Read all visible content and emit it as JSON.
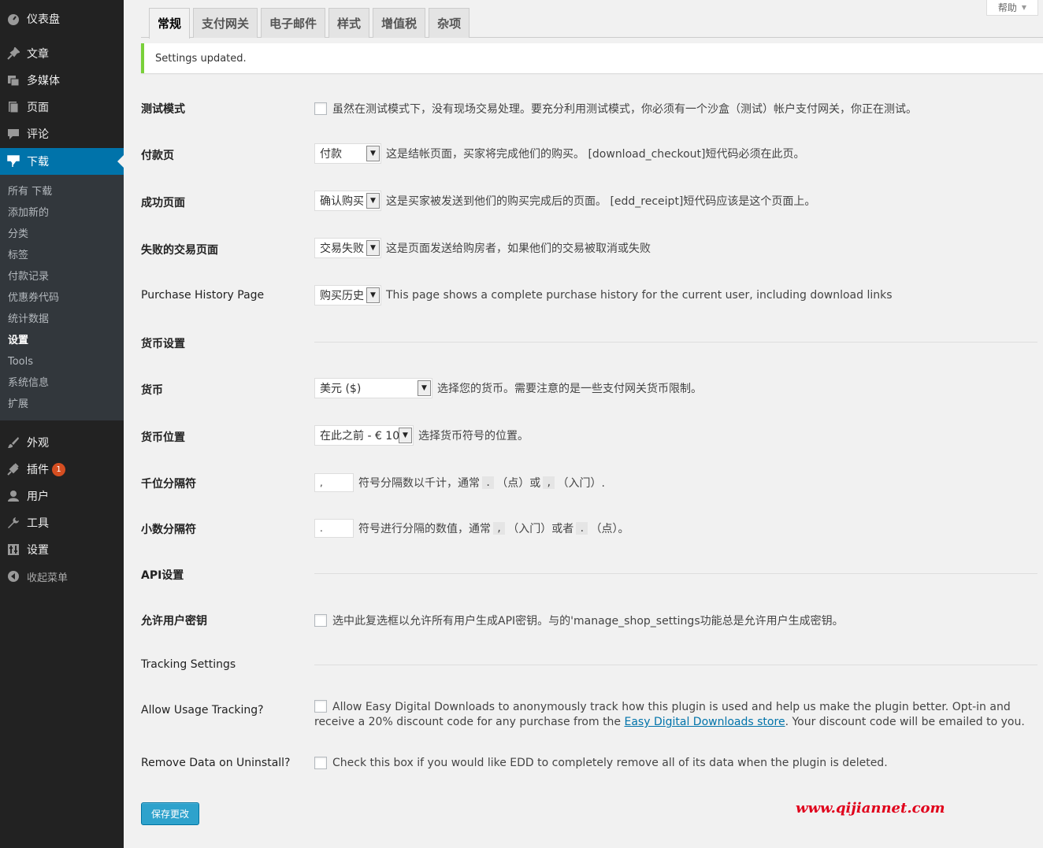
{
  "sidebar": {
    "top_items": [
      {
        "label": "仪表盘",
        "icon": "dashboard-icon"
      },
      {
        "label": "文章",
        "icon": "pin-icon"
      },
      {
        "label": "多媒体",
        "icon": "media-icon"
      },
      {
        "label": "页面",
        "icon": "page-icon"
      },
      {
        "label": "评论",
        "icon": "comment-icon"
      },
      {
        "label": "下载",
        "icon": "download-icon"
      }
    ],
    "submenu": [
      "所有 下载",
      "添加新的",
      "分类",
      "标签",
      "付款记录",
      "优惠券代码",
      "统计数据",
      "设置",
      "Tools",
      "系统信息",
      "扩展"
    ],
    "bottom_items": [
      {
        "label": "外观",
        "icon": "brush-icon"
      },
      {
        "label": "插件",
        "icon": "plugin-icon",
        "badge": "1"
      },
      {
        "label": "用户",
        "icon": "user-icon"
      },
      {
        "label": "工具",
        "icon": "wrench-icon"
      },
      {
        "label": "设置",
        "icon": "settings-icon"
      }
    ],
    "collapse": "收起菜单"
  },
  "help": "帮助",
  "tabs": [
    "常规",
    "支付网关",
    "电子邮件",
    "样式",
    "增值税",
    "杂项"
  ],
  "notice": "Settings updated.",
  "settings": {
    "test_mode": {
      "label": "测试模式",
      "desc": "虽然在测试模式下，没有现场交易处理。要充分利用测试模式，你必须有一个沙盒（测试）帐户支付网关，你正在测试。"
    },
    "checkout": {
      "label": "付款页",
      "value": "付款",
      "desc": "这是结帐页面，买家将完成他们的购买。 [download_checkout]短代码必须在此页。"
    },
    "success": {
      "label": "成功页面",
      "value": "确认购买",
      "desc": "这是买家被发送到他们的购买完成后的页面。 [edd_receipt]短代码应该是这个页面上。"
    },
    "failure": {
      "label": "失败的交易页面",
      "value": "交易失败",
      "desc": "这是页面发送给购房者，如果他们的交易被取消或失败"
    },
    "history": {
      "label": "Purchase History Page",
      "value": "购买历史",
      "desc": "This page shows a complete purchase history for the current user, including download links"
    },
    "currency_section": "货币设置",
    "currency": {
      "label": "货币",
      "value": "美元 ($)",
      "desc": "选择您的货币。需要注意的是一些支付网关货币限制。"
    },
    "currency_position": {
      "label": "货币位置",
      "value": "在此之前 - € 10",
      "desc": "选择货币符号的位置。"
    },
    "thousands": {
      "label": "千位分隔符",
      "value": ",",
      "desc1": "符号分隔数以千计，通常",
      "code1": ".",
      "desc2": "（点）或",
      "code2": ",",
      "desc3": "（入门）."
    },
    "decimal": {
      "label": "小数分隔符",
      "value": ".",
      "desc1": "符号进行分隔的数值，通常",
      "code1": ",",
      "desc2": "（入门）或者",
      "code2": ".",
      "desc3": "（点）。"
    },
    "api_section": "API设置",
    "api_keys": {
      "label": "允许用户密钥",
      "desc": "选中此复选框以允许所有用户生成API密钥。与的'manage_shop_settings功能总是允许用户生成密钥。"
    },
    "tracking_section": "Tracking Settings",
    "tracking": {
      "label": "Allow Usage Tracking?",
      "desc1": "Allow Easy Digital Downloads to anonymously track how this plugin is used and help us make the plugin better. Opt-in and receive a 20% discount code for any purchase from the",
      "link": "Easy Digital Downloads store",
      "desc2": ". Your discount code will be emailed to you."
    },
    "uninstall": {
      "label": "Remove Data on Uninstall?",
      "desc": "Check this box if you would like EDD to completely remove all of its data when the plugin is deleted."
    }
  },
  "save_button": "保存更改",
  "watermark": "www.qijiannet.com",
  "colors": {
    "sidebar": "#222222",
    "active": "#0073aa",
    "notice_border": "#7ad03a",
    "button": "#2ea2cc",
    "watermark": "#e0001b"
  }
}
